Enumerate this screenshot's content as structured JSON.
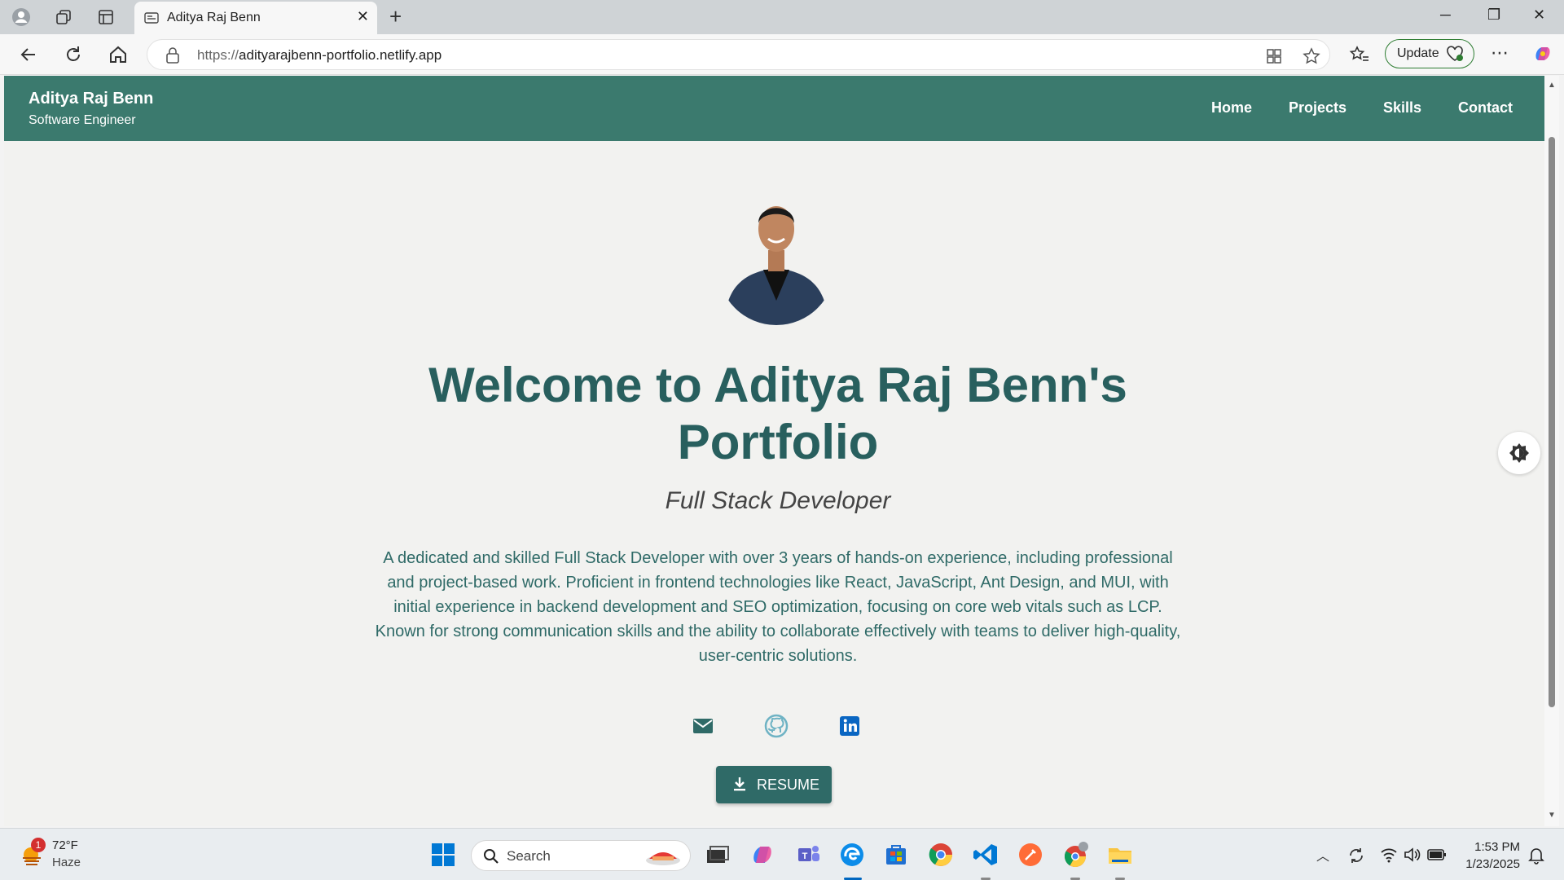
{
  "browser": {
    "tab_title": "Aditya Raj Benn",
    "url_protocol": "https://",
    "url_host": "adityarajbenn-portfolio.netlify.app",
    "update_label": "Update"
  },
  "site": {
    "brand_name": "Aditya Raj Benn",
    "brand_subtitle": "Software Engineer",
    "nav": [
      "Home",
      "Projects",
      "Skills",
      "Contact"
    ],
    "hero_title_line1": "Welcome to Aditya Raj Benn's",
    "hero_title_line2": "Portfolio",
    "hero_subtitle": "Full Stack Developer",
    "bio": "A dedicated and skilled Full Stack Developer with over 3 years of hands-on experience, including professional and project-based work. Proficient in frontend technologies like React, JavaScript, Ant Design, and MUI, with initial experience in backend development and SEO optimization, focusing on core web vitals such as LCP. Known for strong communication skills and the ability to collaborate effectively with teams to deliver high-quality, user-centric solutions.",
    "resume_label": "RESUME",
    "colors": {
      "header_bg": "#3b7a6e",
      "title": "#285f5e",
      "button_bg": "#2f6a67"
    },
    "social_icons": [
      "mail-icon",
      "github-icon",
      "linkedin-icon"
    ]
  },
  "taskbar": {
    "weather_temp": "72°F",
    "weather_condition": "Haze",
    "weather_badge": "1",
    "search_placeholder": "Search",
    "time": "1:53 PM",
    "date": "1/23/2025"
  }
}
